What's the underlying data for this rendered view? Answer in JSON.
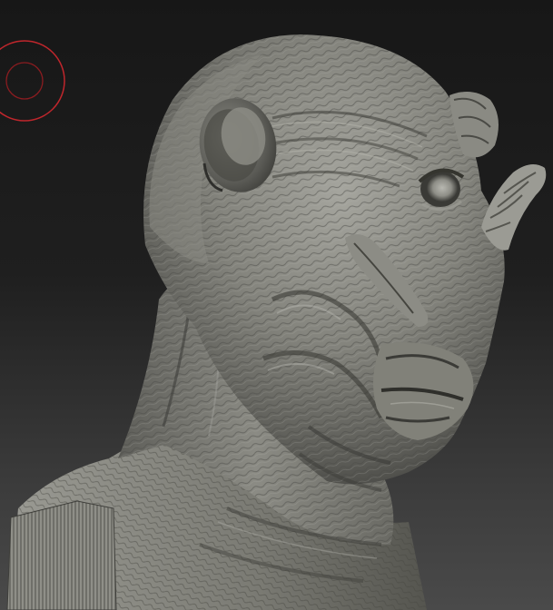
{
  "viewport": {
    "background_top": "#171717",
    "background_bottom": "#4a4a4a"
  },
  "model": {
    "kind": "sculpted-creature-bust",
    "material": "matte-gray-clay",
    "base_color": "#7d7d76",
    "highlight_color": "#b9b9b2",
    "shadow_color": "#2f2f2c"
  },
  "brush_cursor": {
    "outer_color": "#c0262c",
    "inner_color": "#8a1c20"
  }
}
